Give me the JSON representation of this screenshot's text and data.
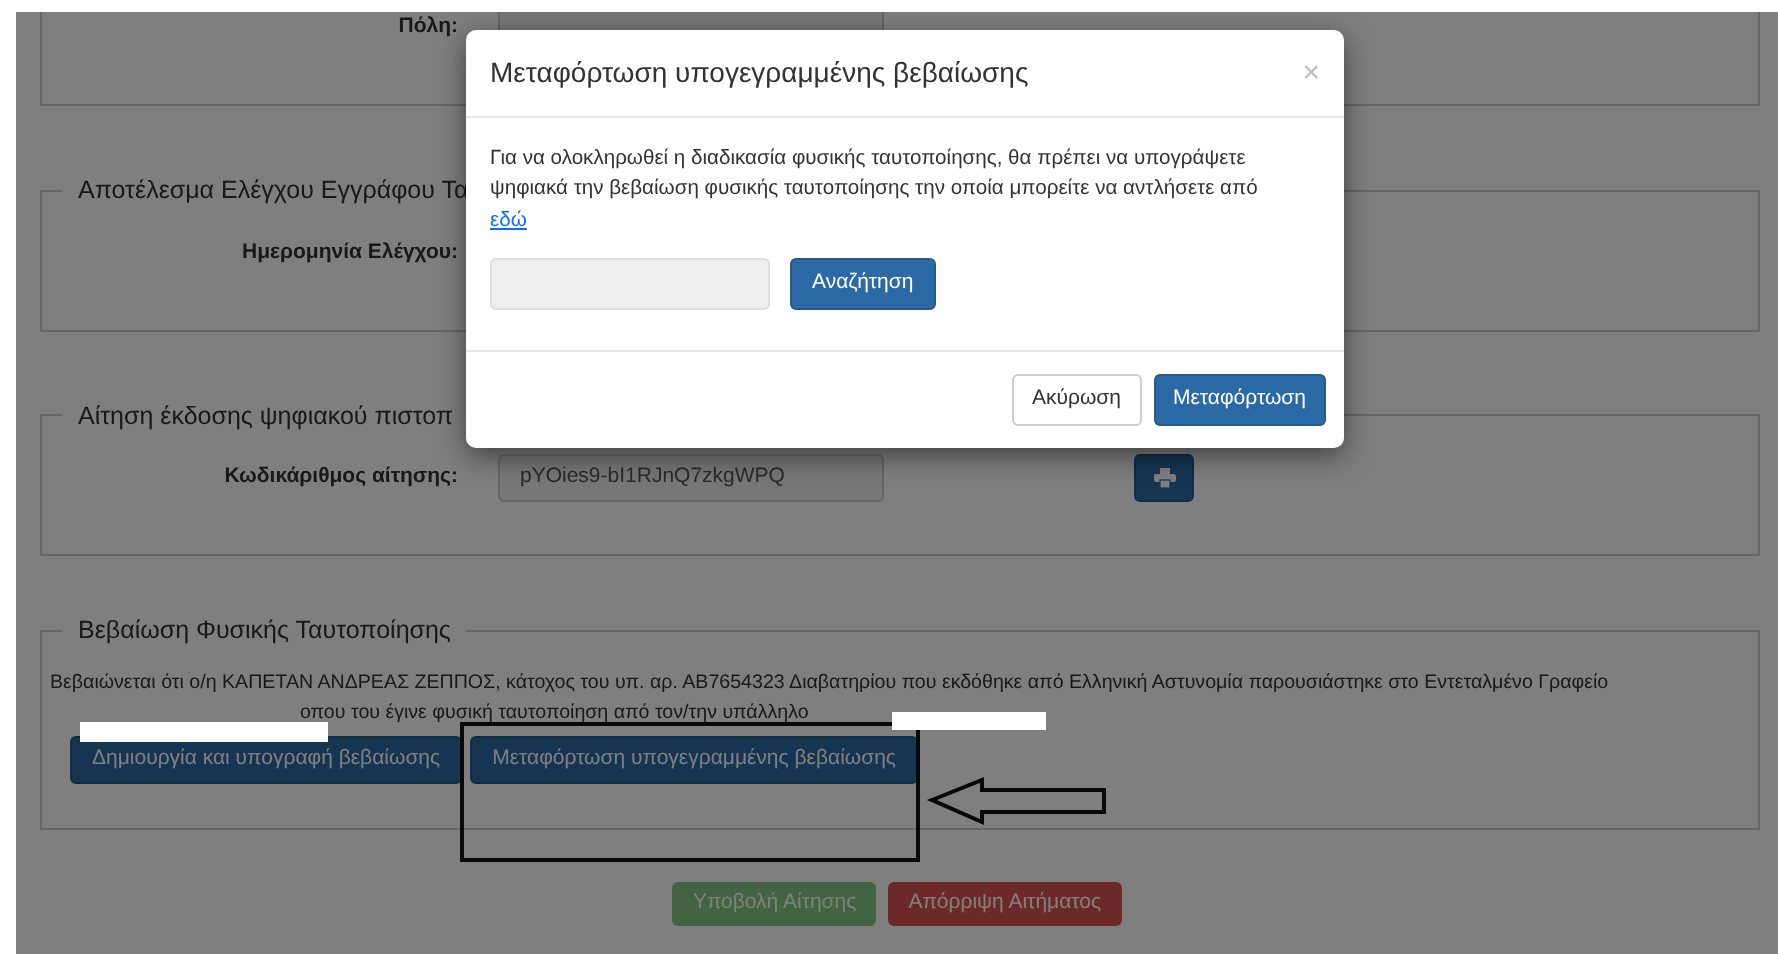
{
  "form": {
    "top_field": {
      "label": "Πόλη:",
      "input_box": true
    },
    "sections": [
      {
        "legend": "Αποτέλεσμα Ελέγχου Εγγράφου Τα",
        "fields": [
          {
            "label": "Ημερομηνία Ελέγχου:"
          }
        ]
      },
      {
        "legend": "Αίτηση έκδοσης ψηφιακού πιστοπ",
        "fields": [
          {
            "label": "Κωδικάριθμος αίτησης:",
            "value": "pYOies9-bI1RJnQ7zkgWPQ",
            "print_button": true
          }
        ]
      }
    ],
    "verification": {
      "legend": "Βεβαίωση Φυσικής Ταυτοποίησης",
      "line_1": "Βεβαιώνεται ότι ο/η ΚΑΠΕΤΑΝ ΑΝΔΡΕΑΣ ΖΕΠΠΟΣ, κάτοχος του υπ. αρ. ΑΒ7654323 Διαβατηρίου που εκδόθηκε από Ελληνική Αστυνομία παρουσιάστηκε στο Εντεταλμένο Γραφείο",
      "line_2": "οπου του έγινε φυσική ταυτοποίηση από τον/την υπάλληλο",
      "buttons": [
        {
          "label": "Δημιουργία και υπογραφή βεβαίωσης"
        },
        {
          "label": "Μεταφόρτωση υπογεγραμμένης βεβαίωσης"
        }
      ]
    },
    "actions": [
      {
        "kind": "submit",
        "label": "Υποβολή Αίτησης"
      },
      {
        "kind": "reject",
        "label": "Απόρριψη Αιτήματος"
      }
    ]
  },
  "modal": {
    "title": "Μεταφόρτωση υπογεγραμμένης βεβαίωσης",
    "close": "×",
    "text": "Για να ολοκληρωθεί η διαδικασία φυσικής ταυτοποίησης, θα πρέπει να υπογράψετε ψηφιακά την βεβαίωση φυσικής ταυτοποίησης την οποία μπορείτε να αντλήσετε από",
    "link": "εδώ",
    "search_button": "Αναζήτηση",
    "footer_buttons": [
      {
        "kind": "default",
        "label": "Ακύρωση"
      },
      {
        "kind": "primary",
        "label": "Μεταφόρτωση"
      }
    ]
  }
}
